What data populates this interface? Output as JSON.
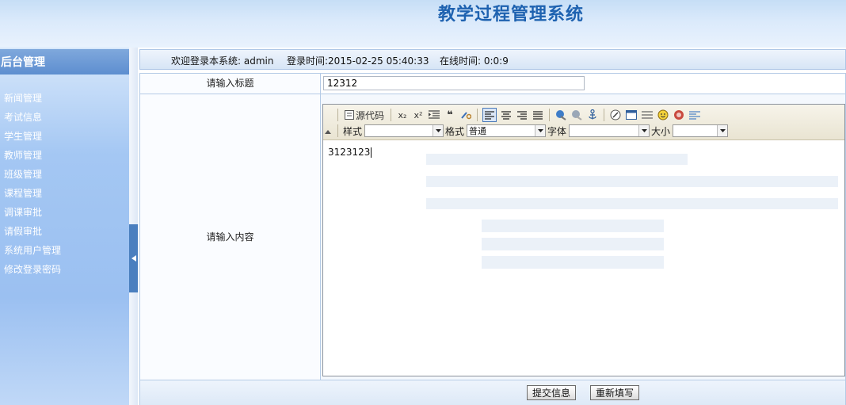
{
  "header": {
    "title": "教学过程管理系统"
  },
  "sidebar": {
    "heading": "后台管理",
    "items": [
      {
        "label": "新闻管理"
      },
      {
        "label": "考试信息"
      },
      {
        "label": "学生管理"
      },
      {
        "label": "教师管理"
      },
      {
        "label": "班级管理"
      },
      {
        "label": "课程管理"
      },
      {
        "label": "调课审批"
      },
      {
        "label": "请假审批"
      },
      {
        "label": "系统用户管理"
      },
      {
        "label": "修改登录密码"
      }
    ]
  },
  "infobar": {
    "welcome": "欢迎登录本系统: admin",
    "login_time": "登录时间:2015-02-25 05:40:33",
    "online_time": "在线时间: 0:0:9"
  },
  "form": {
    "title_label": "请输入标题",
    "title_value": "12312",
    "content_label": "请输入内容",
    "content_value": "3123123"
  },
  "editor": {
    "source_label": "源代码",
    "style_label": "样式",
    "style_value": "",
    "format_label": "格式",
    "format_value": "普通",
    "font_label": "字体",
    "font_value": "",
    "size_label": "大小",
    "size_value": ""
  },
  "actions": {
    "submit_label": "提交信息",
    "reset_label": "重新填写"
  },
  "colors": {
    "title": "#1e62b0",
    "sidebar_head": "#5d8ed0",
    "sidebar_bg": "#9bc0f1"
  }
}
